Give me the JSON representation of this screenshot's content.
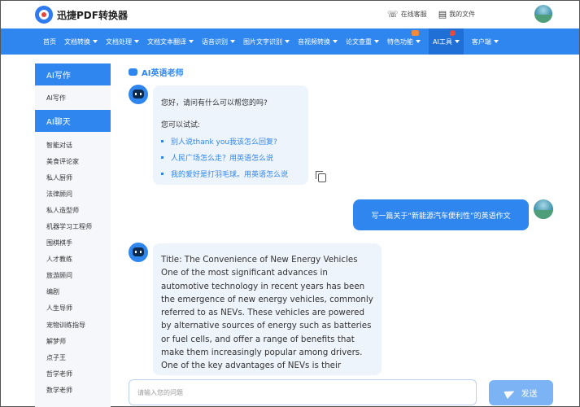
{
  "header": {
    "logo_text": "迅捷PDF转换器",
    "service": "在线客服",
    "my_files": "我的文件"
  },
  "nav": {
    "items": [
      {
        "label": "首页",
        "caret": false
      },
      {
        "label": "文档转换",
        "caret": true
      },
      {
        "label": "文档处理",
        "caret": true
      },
      {
        "label": "文档文本翻译",
        "caret": true
      },
      {
        "label": "语音识别",
        "caret": true
      },
      {
        "label": "图片文字识别",
        "caret": true
      },
      {
        "label": "音视频转换",
        "caret": true
      },
      {
        "label": "论文查重",
        "caret": true
      },
      {
        "label": "特色功能",
        "caret": true
      },
      {
        "label": "AI工具",
        "caret": true
      },
      {
        "label": "客户端",
        "caret": true
      }
    ]
  },
  "sidebar": {
    "head1": "AI写作",
    "sub1": "AI写作",
    "head2": "AI聊天",
    "items": [
      "智能对话",
      "美食评论家",
      "私人厨师",
      "法律顾问",
      "私人造型师",
      "机器学习工程师",
      "围棋棋手",
      "人才教练",
      "旅游顾问",
      "编剧",
      "人生导师",
      "宠物训练指导",
      "解梦师",
      "点子王",
      "哲学老师",
      "数学老师"
    ]
  },
  "chat": {
    "title": "AI英语老师",
    "greeting": "您好，请问有什么可以帮您的吗?",
    "try_label": "您可以试试:",
    "suggestions": [
      "别人说thank you我该怎么回复?",
      "人民广场怎么走？用英语怎么说",
      "我的爱好是打羽毛球。用英语怎么说"
    ],
    "user_message": "写一篇关于“新能源汽车便利性”的英语作文",
    "answer": "Title: The Convenience of New Energy Vehicles One of the most significant advances in automotive technology in recent years has been the emergence of new energy vehicles, commonly referred to as NEVs. These vehicles are powered by alternative sources of energy such as batteries or fuel cells, and offer a range of benefits that make them increasingly popular among drivers. One of the key advantages of NEVs is their efficiency. Using renewable sources of energy, NEVs"
  },
  "input": {
    "placeholder": "请输入您的问题",
    "send_label": "发送"
  }
}
